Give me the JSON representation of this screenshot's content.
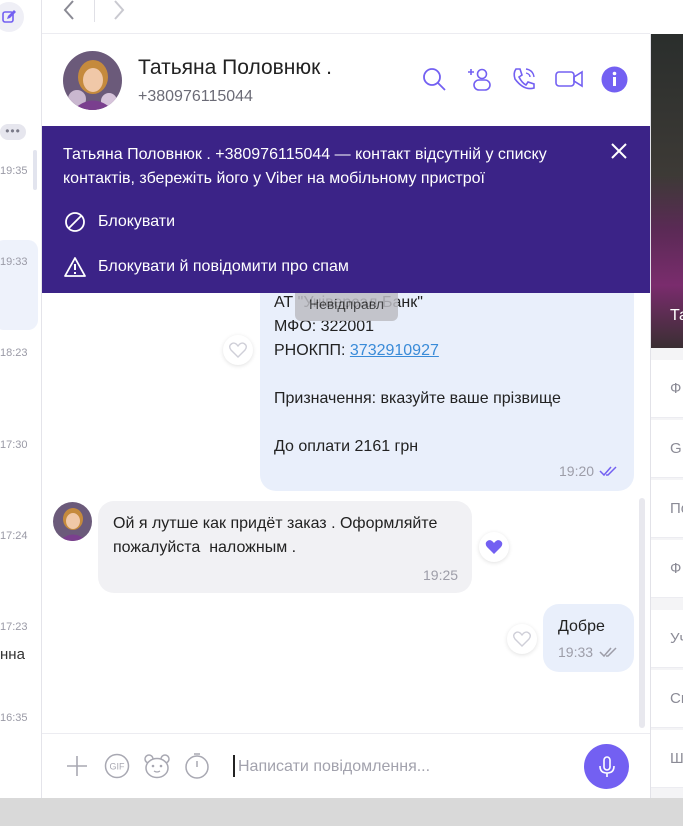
{
  "left_list": {
    "more_label": "•••",
    "times": [
      "19:35",
      "19:33",
      "18:23",
      "17:30",
      "17:24",
      "17:23",
      "16:35"
    ],
    "name_fragment": "нна"
  },
  "contact": {
    "name": "Татьяна Половнюк .",
    "phone": "+380976115044"
  },
  "banner": {
    "text": "Татьяна  Половнюк . +380976115044 — контакт відсутній у списку контактів, збережіть його у Viber на мобільному пристрої",
    "block_label": "Блокувати",
    "block_report_label": "Блокувати й повідомити про спам",
    "bg_color": "#3b2387"
  },
  "messages": {
    "tooltip": "Невідправл",
    "outgoing_1": {
      "line_bank": "АТ \"Універсал Банк\"",
      "line_mfo": "МФО: 322001",
      "line_rnokpp_label": "РНОКПП: ",
      "line_rnokpp_link": "3732910927",
      "line_purpose": "Призначення: вказуйте ваше прізвище",
      "line_amount": "До оплати 2161 грн",
      "time": "19:20"
    },
    "incoming_1": {
      "text": "Ой я лутше как придёт заказ . Оформляйте пожалуйста  наложным .",
      "time": "19:25"
    },
    "outgoing_2": {
      "text": "Добре",
      "time": "19:33"
    }
  },
  "composer": {
    "placeholder": "Написати повідомлення..."
  },
  "right_panel": {
    "photo_label": "Та",
    "items": [
      "Ф",
      "GI",
      "По",
      "Ф",
      "Уч",
      "Сп",
      "Ш"
    ]
  },
  "colors": {
    "accent": "#7360f2",
    "outgoing_bubble": "#e9effb",
    "incoming_bubble": "#f1f1f4",
    "link": "#3a8bd8"
  },
  "icons": [
    "compose-icon",
    "back-arrow-icon",
    "forward-arrow-icon",
    "search-icon",
    "add-participant-icon",
    "call-icon",
    "video-call-icon",
    "info-icon",
    "close-icon",
    "block-icon",
    "warning-icon",
    "heart-icon",
    "plus-icon",
    "gif-icon",
    "sticker-icon",
    "timer-icon",
    "microphone-icon",
    "read-ticks-icon"
  ]
}
